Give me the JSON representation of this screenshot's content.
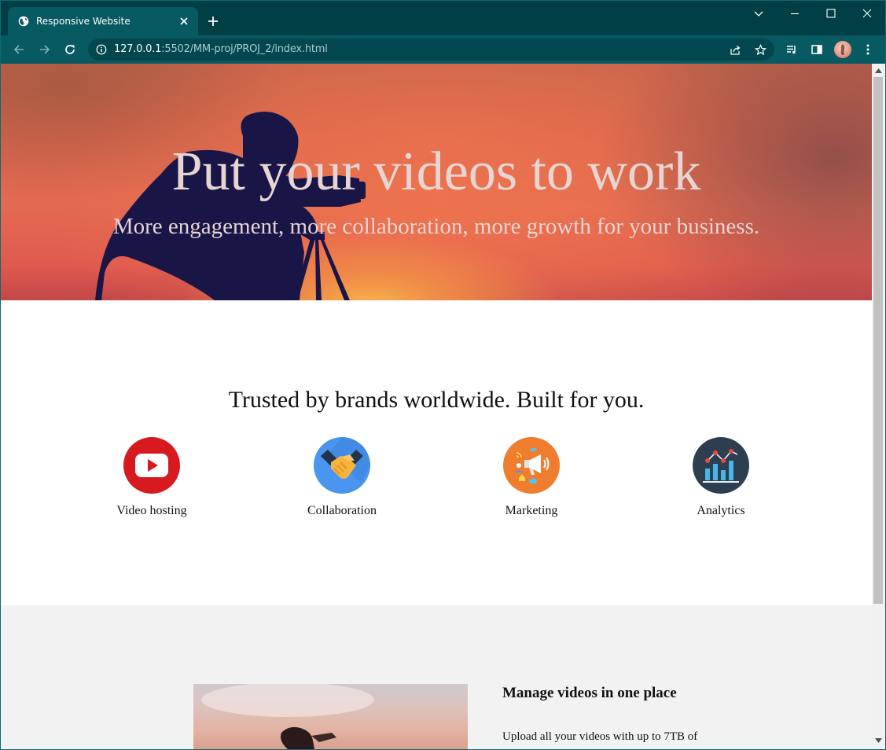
{
  "browser": {
    "tab_title": "Responsive Website",
    "url_host": "127.0.0.1",
    "url_path": ":5502/MM-proj/PROJ_2/index.html"
  },
  "hero": {
    "title": "Put your videos to work",
    "subtitle": "More engagement, more collaboration, more growth for your business."
  },
  "features": {
    "heading": "Trusted by brands worldwide. Built for you.",
    "items": [
      {
        "label": "Video hosting",
        "icon": "youtube-play-icon",
        "color": "#d71a20"
      },
      {
        "label": "Collaboration",
        "icon": "handshake-icon",
        "color": "#4a95f0"
      },
      {
        "label": "Marketing",
        "icon": "megaphone-icon",
        "color": "#f07c2e"
      },
      {
        "label": "Analytics",
        "icon": "bar-chart-icon",
        "color": "#2c3e50"
      }
    ]
  },
  "manage": {
    "heading": "Manage videos in one place",
    "text": "Upload all your videos with up to 7TB of"
  },
  "colors": {
    "tab_strip": "#003f45",
    "toolbar": "#075a62",
    "section_alt_bg": "#f2f2f2"
  }
}
